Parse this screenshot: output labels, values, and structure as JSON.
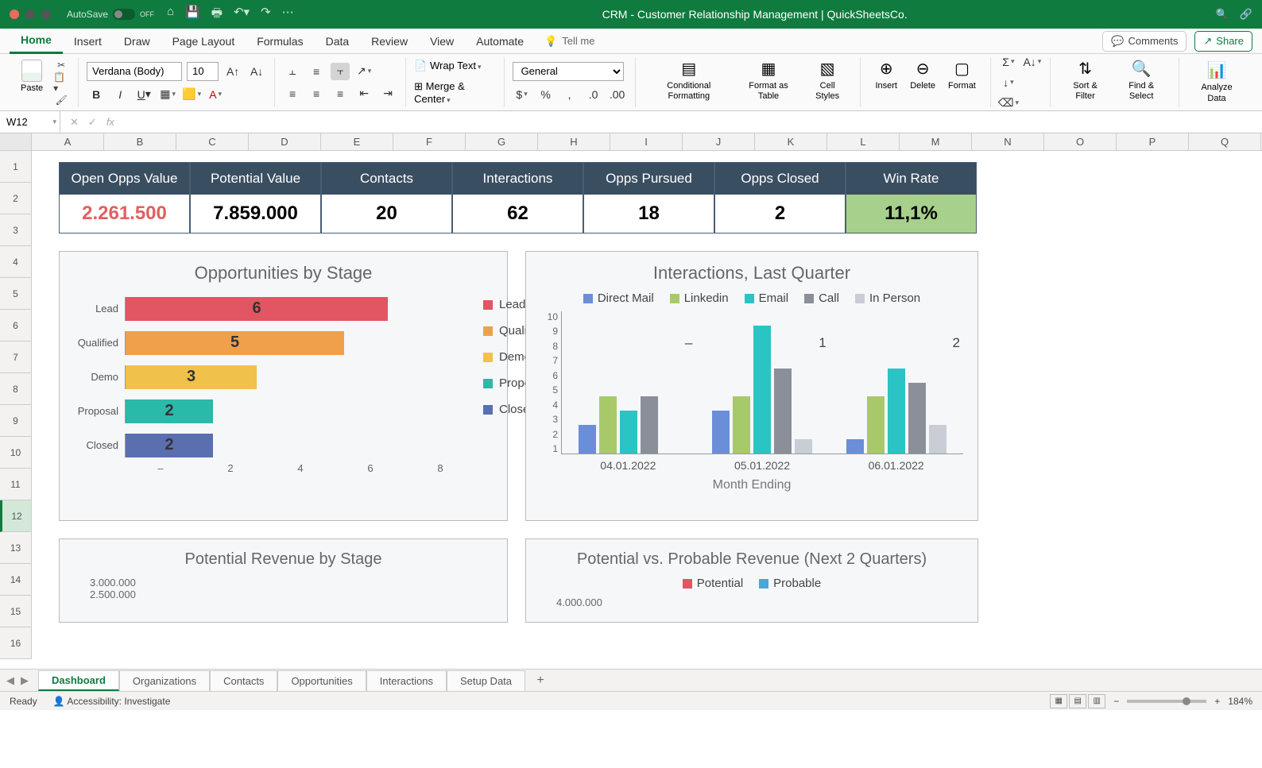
{
  "titlebar": {
    "autosave_label": "AutoSave",
    "autosave_state": "OFF",
    "doc_title": "CRM - Customer Relationship Management | QuickSheetsCo."
  },
  "ribbon_tabs": [
    "Home",
    "Insert",
    "Draw",
    "Page Layout",
    "Formulas",
    "Data",
    "Review",
    "View",
    "Automate"
  ],
  "tell_me": "Tell me",
  "comments_label": "Comments",
  "share_label": "Share",
  "ribbon": {
    "paste": "Paste",
    "font_name": "Verdana (Body)",
    "font_size": "10",
    "wrap_text": "Wrap Text",
    "merge_center": "Merge & Center",
    "number_format": "General",
    "cond_fmt": "Conditional Formatting",
    "fmt_table": "Format as Table",
    "cell_styles": "Cell Styles",
    "insert": "Insert",
    "delete": "Delete",
    "format": "Format",
    "sort_filter": "Sort & Filter",
    "find_select": "Find & Select",
    "analyze": "Analyze Data"
  },
  "name_box": "W12",
  "columns": [
    "A",
    "B",
    "C",
    "D",
    "E",
    "F",
    "G",
    "H",
    "I",
    "J",
    "K",
    "L",
    "M",
    "N",
    "O",
    "P",
    "Q"
  ],
  "rows": [
    "1",
    "2",
    "3",
    "4",
    "5",
    "6",
    "7",
    "8",
    "9",
    "10",
    "11",
    "12",
    "13",
    "14",
    "15",
    "16"
  ],
  "selected_row": 12,
  "kpis": [
    {
      "label": "Open Opps Value",
      "value": "2.261.500"
    },
    {
      "label": "Potential Value",
      "value": "7.859.000"
    },
    {
      "label": "Contacts",
      "value": "20"
    },
    {
      "label": "Interactions",
      "value": "62"
    },
    {
      "label": "Opps Pursued",
      "value": "18"
    },
    {
      "label": "Opps Closed",
      "value": "2"
    },
    {
      "label": "Win Rate",
      "value": "11,1%"
    }
  ],
  "chart_data": [
    {
      "type": "bar",
      "orientation": "horizontal",
      "title": "Opportunities by Stage",
      "categories": [
        "Lead",
        "Qualified",
        "Demo",
        "Proposal",
        "Closed"
      ],
      "values": [
        6,
        5,
        3,
        2,
        2
      ],
      "colors": [
        "#e25563",
        "#f0a04b",
        "#f0c24b",
        "#2bb9a9",
        "#5a6fb0"
      ],
      "xlim": [
        0,
        8
      ],
      "xticks": [
        "–",
        "2",
        "4",
        "6",
        "8"
      ],
      "legend": [
        "Lead",
        "Qualified",
        "Demo",
        "Proposal",
        "Closed"
      ]
    },
    {
      "type": "bar",
      "orientation": "vertical",
      "title": "Interactions, Last Quarter",
      "x": [
        "04.01.2022",
        "05.01.2022",
        "06.01.2022"
      ],
      "series": [
        {
          "name": "Direct Mail",
          "color": "#6a8fd8",
          "values": [
            2,
            3,
            1
          ]
        },
        {
          "name": "Linkedin",
          "color": "#a8c96a",
          "values": [
            4,
            4,
            4
          ]
        },
        {
          "name": "Email",
          "color": "#2bc4c4",
          "values": [
            3,
            9,
            6
          ]
        },
        {
          "name": "Call",
          "color": "#8a8f9a",
          "values": [
            4,
            6,
            5
          ]
        },
        {
          "name": "In Person",
          "color": "#c8cdd6",
          "values": [
            0,
            1,
            2
          ]
        }
      ],
      "ylim": [
        0,
        10
      ],
      "yticks": [
        "1",
        "2",
        "3",
        "4",
        "5",
        "6",
        "7",
        "8",
        "9",
        "10"
      ],
      "xlabel": "Month Ending",
      "labels_end": [
        "–",
        "1",
        "2"
      ]
    },
    {
      "type": "bar",
      "title": "Potential Revenue by Stage",
      "yticks_visible": [
        "3.000.000",
        "2.500.000"
      ]
    },
    {
      "type": "bar",
      "title": "Potential vs. Probable Revenue (Next 2 Quarters)",
      "legend": [
        {
          "name": "Potential",
          "color": "#e25563"
        },
        {
          "name": "Probable",
          "color": "#4aa8d8"
        }
      ],
      "yticks_visible": [
        "4.000.000"
      ]
    }
  ],
  "sheet_tabs": [
    "Dashboard",
    "Organizations",
    "Contacts",
    "Opportunities",
    "Interactions",
    "Setup Data"
  ],
  "active_sheet": 0,
  "status": {
    "ready": "Ready",
    "accessibility": "Accessibility: Investigate",
    "zoom": "184%"
  }
}
